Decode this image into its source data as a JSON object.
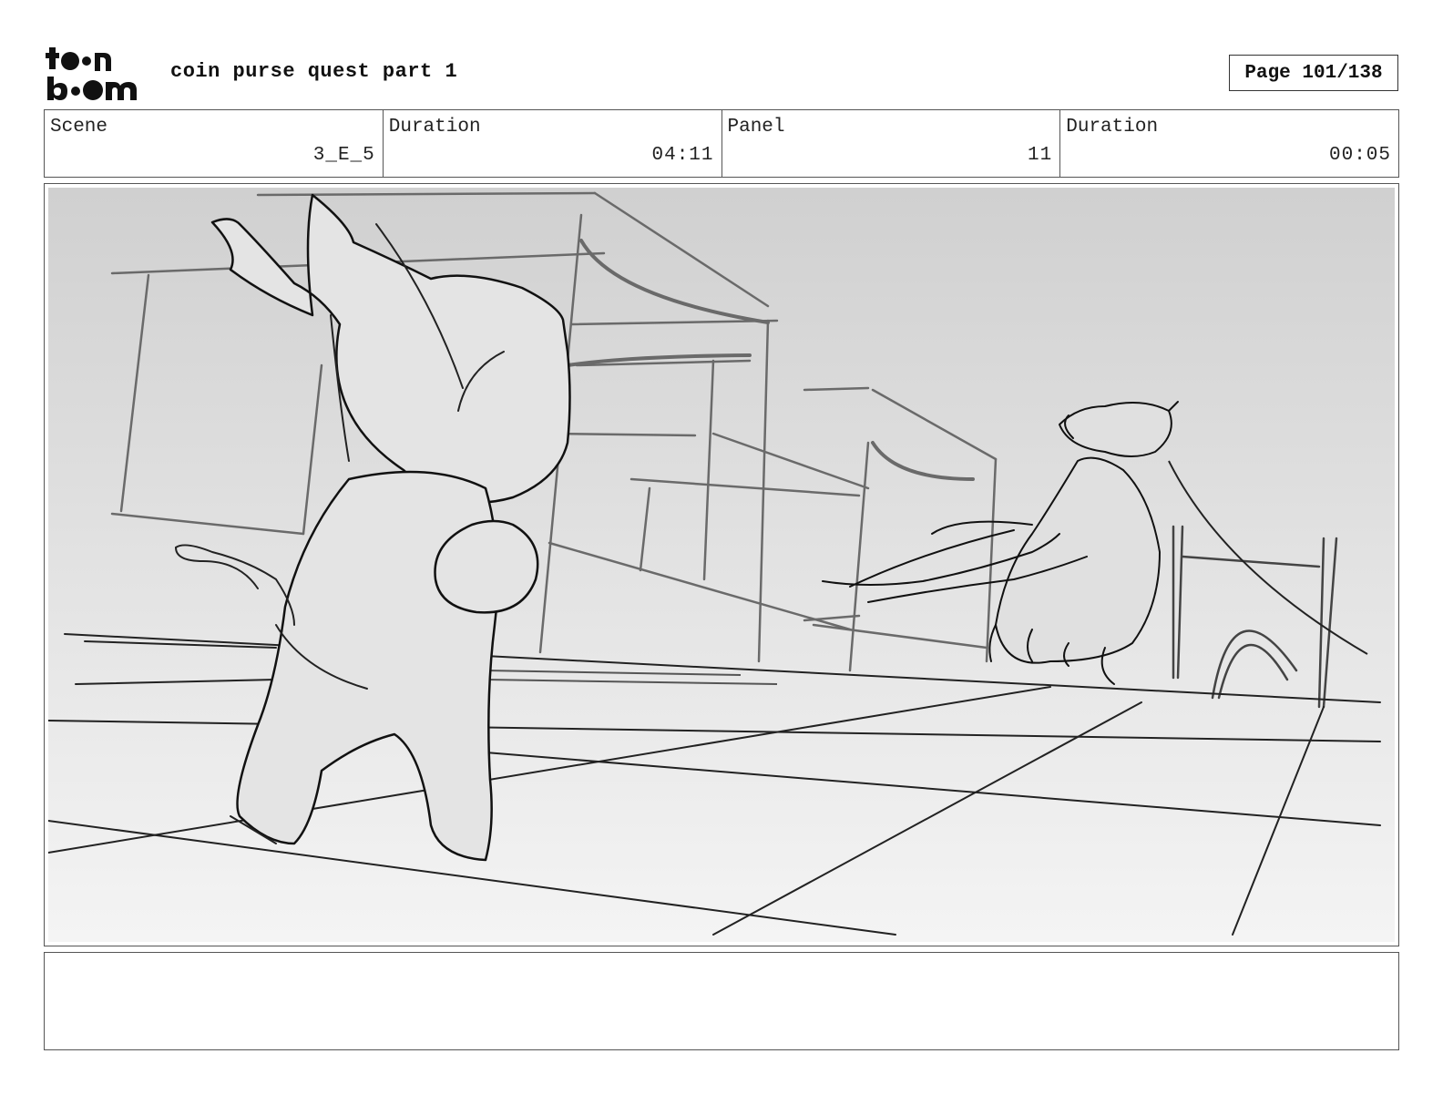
{
  "header": {
    "logo_text": "toon boom",
    "project_title": "coin purse quest part 1",
    "page_label": "Page 101/138"
  },
  "info": [
    {
      "label": "Scene",
      "value": "3_E_5"
    },
    {
      "label": "Duration",
      "value": "04:11"
    },
    {
      "label": "Panel",
      "value": "11"
    },
    {
      "label": "Duration",
      "value": "00:05"
    }
  ],
  "panel": {
    "image_icon": "storyboard-sketch"
  },
  "notes": {
    "text": ""
  }
}
